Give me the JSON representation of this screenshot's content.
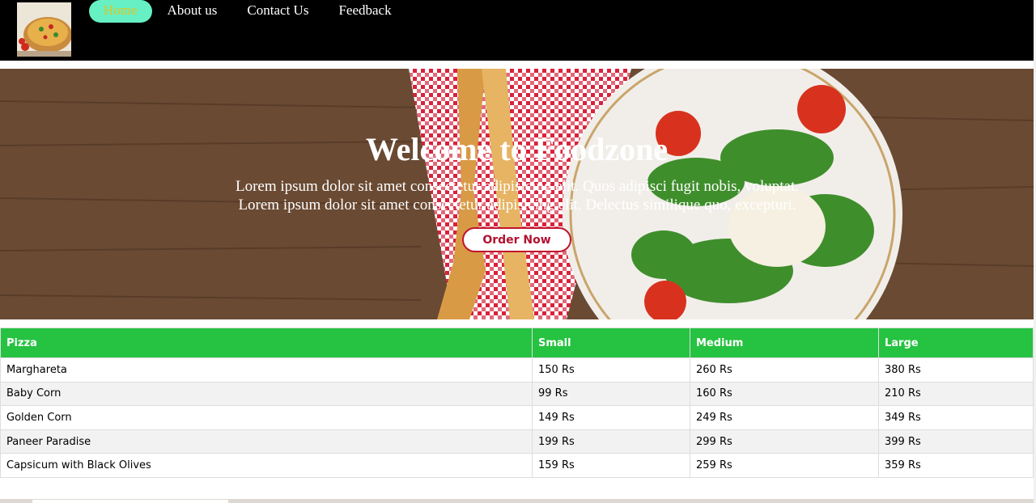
{
  "nav": {
    "logo_alt": "Pizza logo",
    "links": [
      {
        "label": "Home",
        "active": true
      },
      {
        "label": "About us",
        "active": false
      },
      {
        "label": "Contact Us",
        "active": false
      },
      {
        "label": "Feedback",
        "active": false
      }
    ]
  },
  "hero": {
    "title": "Welcome to Foodzone",
    "text_line1": "Lorem ipsum dolor sit amet consectetur adipisicing elit. Quos adipisci fugit nobis, voluptat.",
    "text_line2": "Lorem ipsum dolor sit amet consectetur adipisicing elit. Delectus similique quo, excepturi.",
    "cta_label": "Order Now"
  },
  "menu_table": {
    "headers": [
      "Pizza",
      "Small",
      "Medium",
      "Large"
    ],
    "rows": [
      [
        "Marghareta",
        "150 Rs",
        "260 Rs",
        "380 Rs"
      ],
      [
        "Baby Corn",
        "99 Rs",
        "160 Rs",
        "210 Rs"
      ],
      [
        "Golden Corn",
        "149 Rs",
        "249 Rs",
        "349 Rs"
      ],
      [
        "Paneer Paradise",
        "199 Rs",
        "299 Rs",
        "399 Rs"
      ],
      [
        "Capsicum with Black Olives",
        "159 Rs",
        "259 Rs",
        "359 Rs"
      ]
    ]
  },
  "colors": {
    "nav_bg": "#000000",
    "active_pill": "#66f0c3",
    "active_text": "#e3c51f",
    "table_header": "#26c241",
    "cta_border": "#c0142c"
  }
}
